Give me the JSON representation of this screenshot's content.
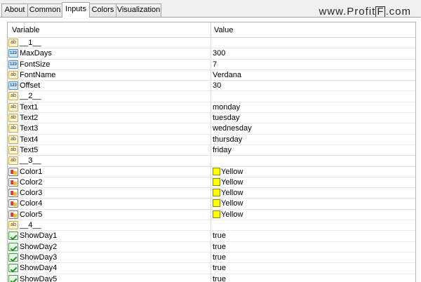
{
  "tabs": [
    "About",
    "Common",
    "Inputs",
    "Colors",
    "Visualization"
  ],
  "active_tab": "Inputs",
  "watermark": {
    "prefix": "www.Profit",
    "boxed": "F",
    "suffix": ".com"
  },
  "columns": {
    "variable": "Variable",
    "value": "Value"
  },
  "rows": [
    {
      "type": "str",
      "name": "__1__",
      "value": ""
    },
    {
      "type": "int",
      "name": "MaxDays",
      "value": "300"
    },
    {
      "type": "int",
      "name": "FontSize",
      "value": "7"
    },
    {
      "type": "str",
      "name": "FontName",
      "value": "Verdana"
    },
    {
      "type": "int",
      "name": "Offset",
      "value": "30"
    },
    {
      "type": "str",
      "name": "__2__",
      "value": ""
    },
    {
      "type": "str",
      "name": "Text1",
      "value": "monday"
    },
    {
      "type": "str",
      "name": "Text2",
      "value": "tuesday"
    },
    {
      "type": "str",
      "name": "Text3",
      "value": "wednesday"
    },
    {
      "type": "str",
      "name": "Text4",
      "value": "thursday"
    },
    {
      "type": "str",
      "name": "Text5",
      "value": "friday"
    },
    {
      "type": "str",
      "name": "__3__",
      "value": ""
    },
    {
      "type": "col",
      "name": "Color1",
      "value": "Yellow",
      "color": "#ffff00"
    },
    {
      "type": "col",
      "name": "Color2",
      "value": "Yellow",
      "color": "#ffff00"
    },
    {
      "type": "col",
      "name": "Color3",
      "value": "Yellow",
      "color": "#ffff00"
    },
    {
      "type": "col",
      "name": "Color4",
      "value": "Yellow",
      "color": "#ffff00"
    },
    {
      "type": "col",
      "name": "Color5",
      "value": "Yellow",
      "color": "#ffff00"
    },
    {
      "type": "str",
      "name": "__4__",
      "value": ""
    },
    {
      "type": "bool",
      "name": "ShowDay1",
      "value": "true"
    },
    {
      "type": "bool",
      "name": "ShowDay2",
      "value": "true"
    },
    {
      "type": "bool",
      "name": "ShowDay3",
      "value": "true"
    },
    {
      "type": "bool",
      "name": "ShowDay4",
      "value": "true"
    },
    {
      "type": "bool",
      "name": "ShowDay5",
      "value": "true"
    }
  ],
  "icon_types": {
    "str": "string-icon",
    "int": "integer-icon",
    "col": "color-icon",
    "bool": "bool-icon"
  }
}
